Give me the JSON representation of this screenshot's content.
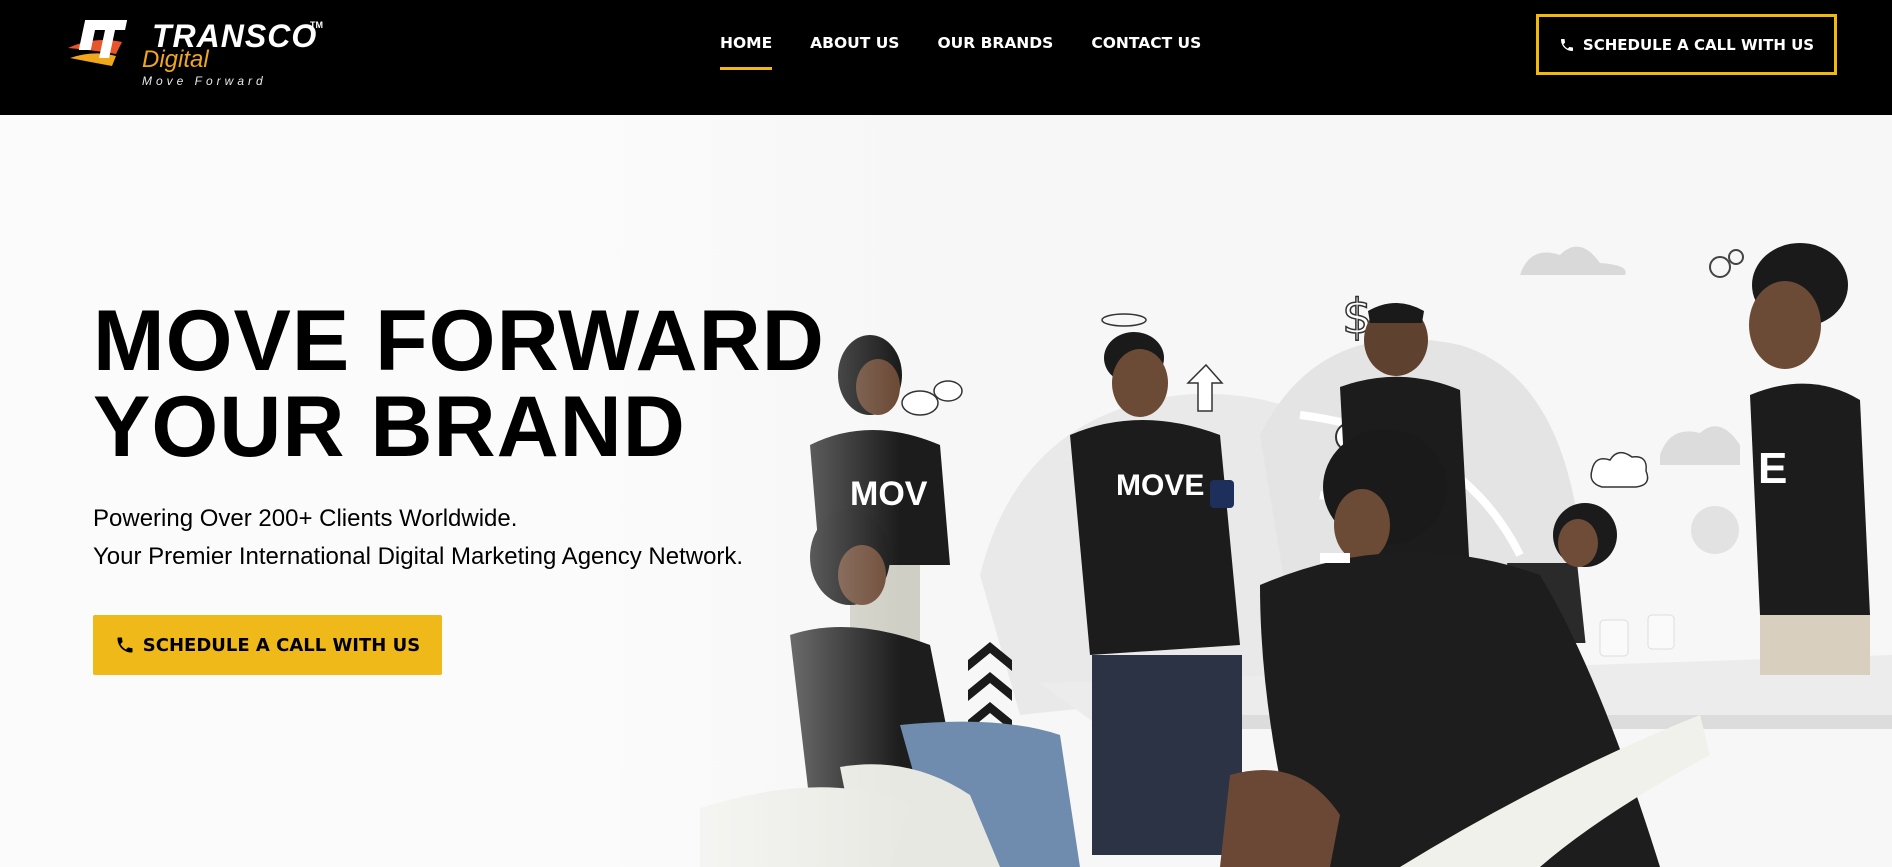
{
  "header": {
    "logo": {
      "word": "TRANSCO",
      "tm": "TM",
      "sub": "Digital",
      "tagline": "Move  Forward"
    },
    "nav": [
      {
        "label": "HOME",
        "active": true
      },
      {
        "label": "ABOUT US",
        "active": false
      },
      {
        "label": "OUR BRANDS",
        "active": false
      },
      {
        "label": "CONTACT US",
        "active": false
      }
    ],
    "cta_label": "SCHEDULE A CALL WITH US"
  },
  "hero": {
    "title_line1": "MOVE FORWARD",
    "title_line2": "YOUR BRAND",
    "subtitle_line1": "Powering Over 200+ Clients Worldwide.",
    "subtitle_line2": "Your Premier International Digital Marketing Agency Network.",
    "cta_label": "SCHEDULE A CALL WITH US",
    "shirt_texts": [
      "MOV",
      "MOVE",
      "E"
    ]
  },
  "colors": {
    "header_bg": "#000000",
    "accent": "#f0b91a",
    "hero_bg": "#f7f7f7",
    "text": "#000000",
    "nav_text": "#ffffff"
  },
  "icons": [
    "phone-icon",
    "logo-mark-icon",
    "chevron-up-icon",
    "dollar-icon",
    "lightbulb-icon",
    "arrow-up-icon",
    "gear-icon",
    "speech-bubble-icon",
    "cloud-icon"
  ]
}
